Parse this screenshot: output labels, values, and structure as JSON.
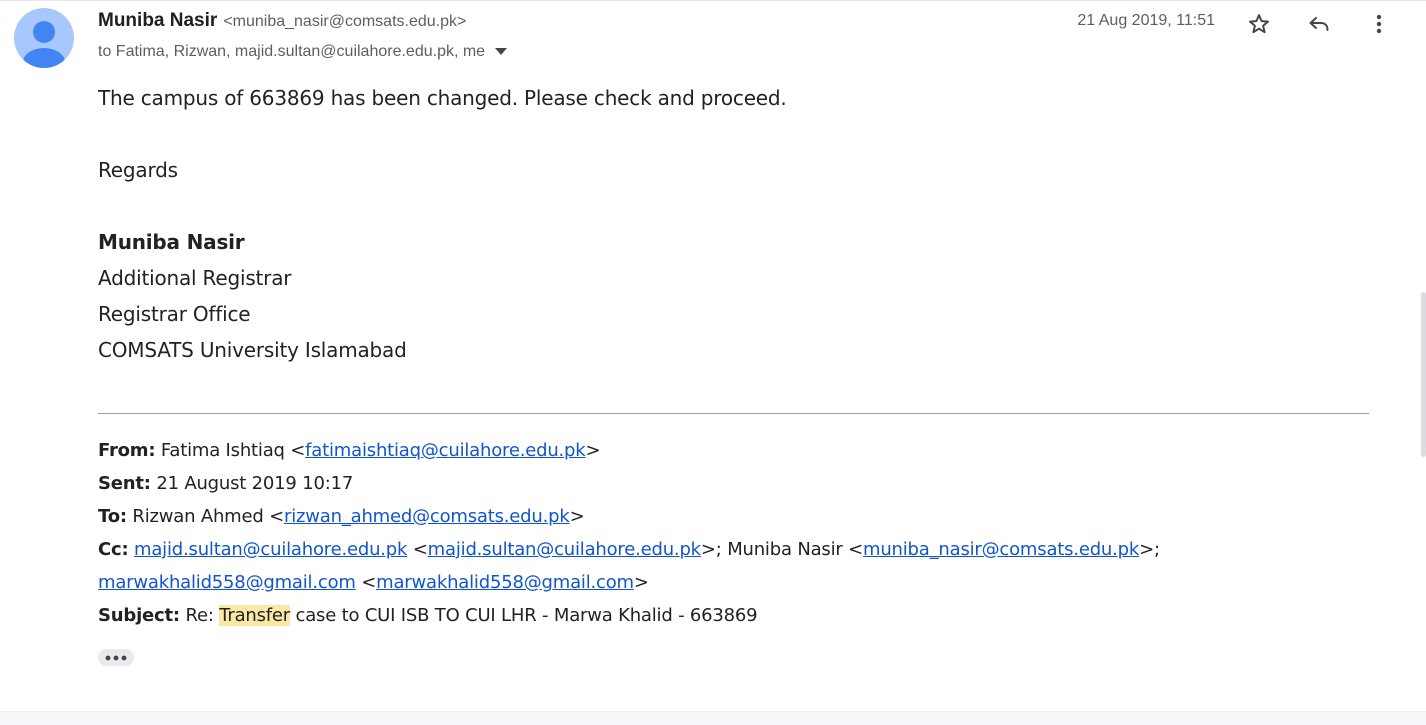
{
  "header": {
    "sender_name": "Muniba Nasir",
    "sender_email": "<muniba_nasir@comsats.edu.pk>",
    "recipients": "to Fatima, Rizwan, majid.sultan@cuilahore.edu.pk, me",
    "date": "21 Aug 2019, 11:51"
  },
  "icons": {
    "avatar": "avatar-icon",
    "star": "star-icon",
    "reply": "reply-icon",
    "more": "more-vert-icon",
    "dropdown": "chevron-down-icon",
    "ellipsis": "more-horiz-icon"
  },
  "body": {
    "line1": "The campus of 663869 has been changed. Please check and proceed.",
    "regards": "Regards",
    "sig_name": "Muniba Nasir",
    "sig_title": "Additional Registrar",
    "sig_office": "Registrar Office",
    "sig_org": "COMSATS University Islamabad"
  },
  "quoted": {
    "from_label": "From:",
    "from_name": "Fatima Ishtiaq <",
    "from_email": "fatimaishtiaq@cuilahore.edu.pk",
    "from_close": ">",
    "sent_label": "Sent:",
    "sent_value": "21 August 2019 10:17",
    "to_label": "To:",
    "to_name": "Rizwan Ahmed <",
    "to_email": "rizwan_ahmed@comsats.edu.pk",
    "to_close": ">",
    "cc_label": "Cc:",
    "cc_email1": "majid.sultan@cuilahore.edu.pk",
    "cc_sep1": " <",
    "cc_email2": "majid.sultan@cuilahore.edu.pk",
    "cc_sep2": ">; Muniba Nasir <",
    "cc_email3": "muniba_nasir@comsats.edu.pk",
    "cc_sep3": ">;",
    "cc_email4": "marwakhalid558@gmail.com",
    "cc_sep4": " <",
    "cc_email5": "marwakhalid558@gmail.com",
    "cc_close": ">",
    "subject_label": "Subject:",
    "subject_prefix": "Re: ",
    "subject_highlight": "Transfer",
    "subject_rest": " case to CUI ISB TO CUI LHR - Marwa Khalid - 663869"
  },
  "colors": {
    "link": "#1155cc",
    "highlight": "#fce8a6",
    "avatar_bg": "#a8c7fa",
    "avatar_fg": "#4285f4"
  }
}
